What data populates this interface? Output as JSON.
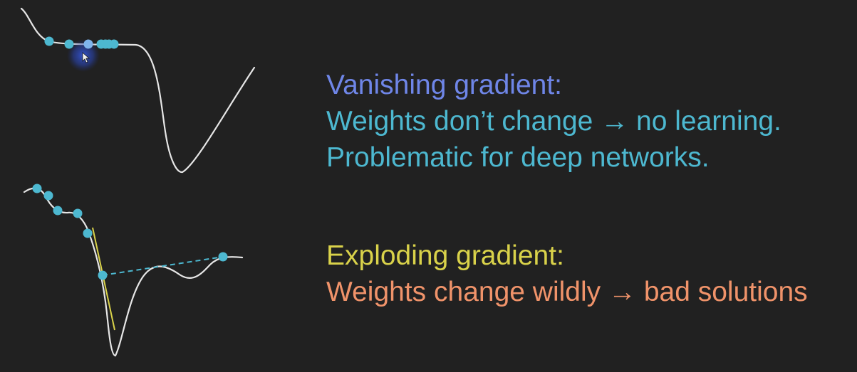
{
  "colors": {
    "background": "#212121",
    "curve": "#e6e6e6",
    "dot": "#4db8d0",
    "dot_selected": "#7fb4ec",
    "dashed_line": "#4db8d0",
    "tangent_line": "#d9d24a",
    "cursor_glow": "#2f4fc4",
    "vanishing_title": "#6f86e8",
    "vanishing_body": "#4db8d0",
    "exploding_title": "#d9d24a",
    "exploding_body": "#f0936a"
  },
  "vanishing": {
    "title": "Vanishing gradient:",
    "line1": "Weights don’t change → no learning.",
    "line2": "Problematic for deep networks."
  },
  "exploding": {
    "title": "Exploding gradient:",
    "line1": "Weights change wildly → bad solutions"
  }
}
